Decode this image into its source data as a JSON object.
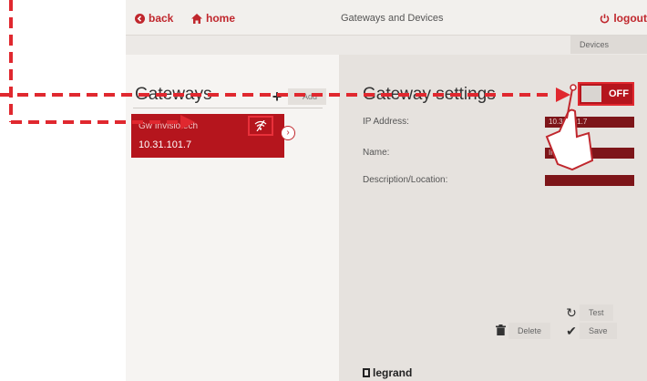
{
  "nav": {
    "back": "back",
    "home": "home",
    "logout": "logout"
  },
  "page_title": "Gateways and Devices",
  "breadcrumb": "Devices",
  "gateways": {
    "heading": "Gateways",
    "add_label": "Add",
    "items": [
      {
        "name": "Gw Invisiotech",
        "ip": "10.31.101.7"
      }
    ]
  },
  "settings": {
    "heading": "Gateway settings",
    "toggle_label": "OFF",
    "fields": {
      "ip_label": "IP Address:",
      "ip_value": "10.31.101.7",
      "name_label": "Name:",
      "name_value": "Invisiotech",
      "desc_label": "Description/Location:",
      "desc_value": ""
    },
    "actions": {
      "test": "Test",
      "delete": "Delete",
      "save": "Save"
    }
  },
  "brand": "legrand",
  "colors": {
    "accent": "#c0272d",
    "card": "#b5151d",
    "annotation": "#e0282f"
  },
  "icons": {
    "back": "chevron-left-circle-icon",
    "home": "home-icon",
    "logout": "power-icon",
    "gateway": "wifi-off-icon",
    "hand": "pointing-hand-icon"
  }
}
